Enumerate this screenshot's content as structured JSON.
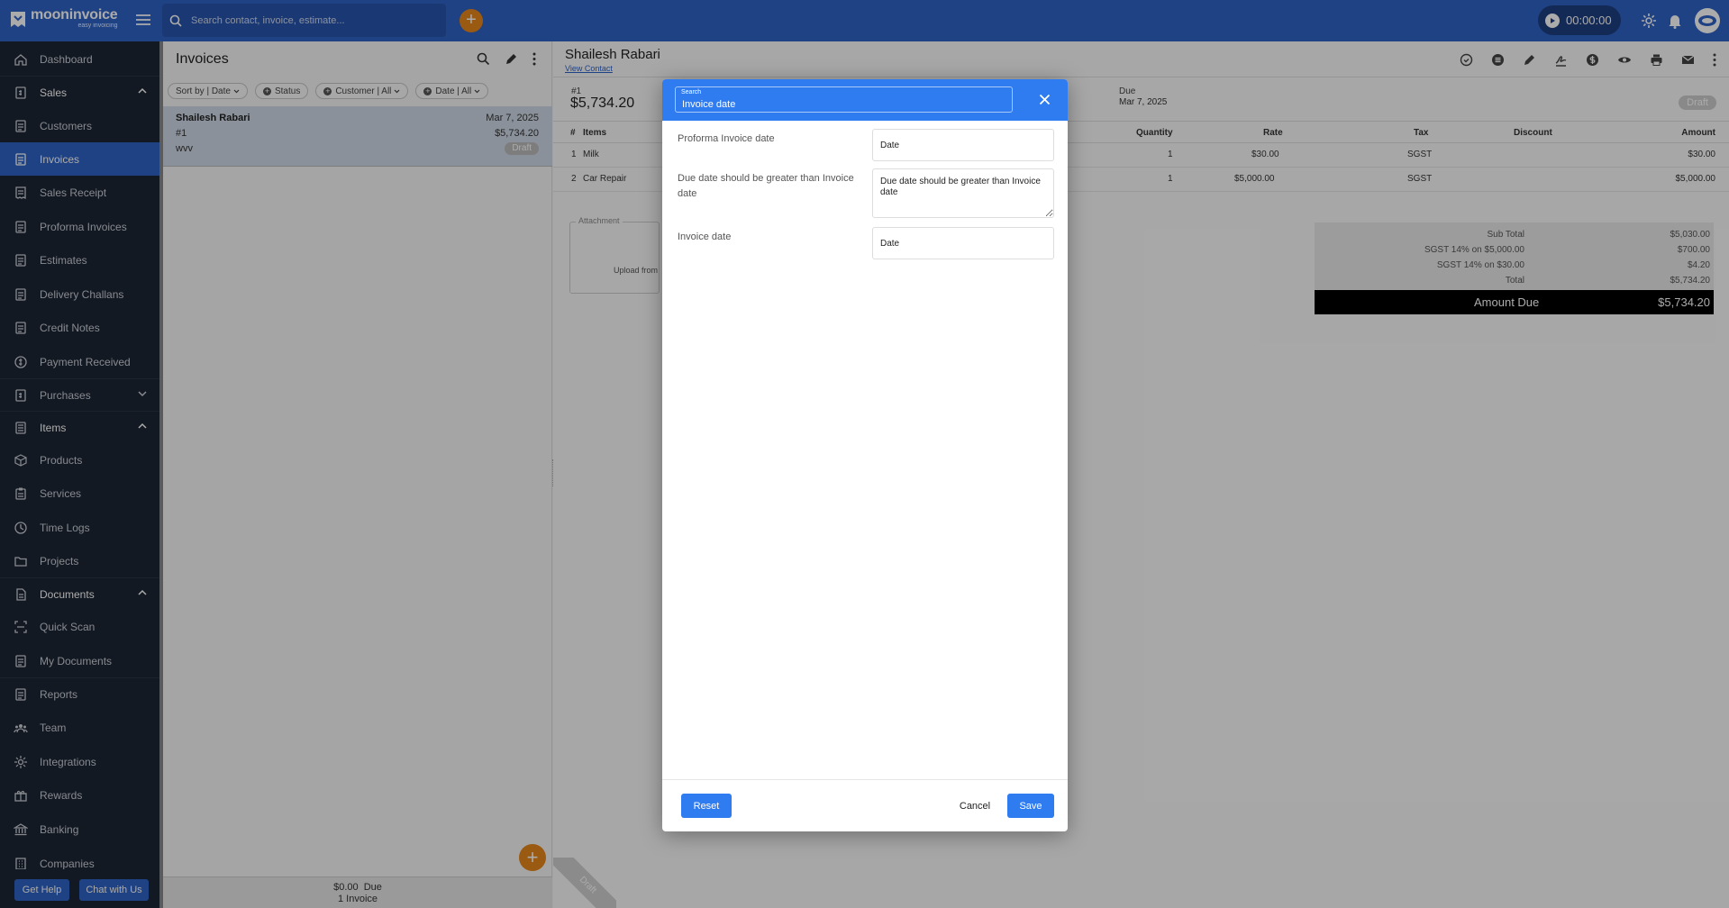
{
  "brand": {
    "name": "mooninvoice",
    "tagline": "easy invoicing"
  },
  "search": {
    "placeholder": "Search contact, invoice, estimate..."
  },
  "timer": {
    "value": "00:00:00"
  },
  "sidebar": {
    "items": [
      {
        "label": "Dashboard"
      },
      {
        "label": "Sales"
      },
      {
        "label": "Customers"
      },
      {
        "label": "Invoices"
      },
      {
        "label": "Sales Receipt"
      },
      {
        "label": "Proforma Invoices"
      },
      {
        "label": "Estimates"
      },
      {
        "label": "Delivery Challans"
      },
      {
        "label": "Credit Notes"
      },
      {
        "label": "Payment Received"
      },
      {
        "label": "Purchases"
      },
      {
        "label": "Items"
      },
      {
        "label": "Products"
      },
      {
        "label": "Services"
      },
      {
        "label": "Time Logs"
      },
      {
        "label": "Projects"
      },
      {
        "label": "Documents"
      },
      {
        "label": "Quick Scan"
      },
      {
        "label": "My Documents"
      },
      {
        "label": "Reports"
      },
      {
        "label": "Team"
      },
      {
        "label": "Integrations"
      },
      {
        "label": "Rewards"
      },
      {
        "label": "Banking"
      },
      {
        "label": "Companies"
      }
    ],
    "help_label": "Get Help",
    "chat_label": "Chat with Us"
  },
  "list": {
    "title": "Invoices",
    "filters": {
      "sort": "Sort by | Date",
      "status": "Status",
      "customer": "Customer | All",
      "date": "Date | All"
    },
    "card": {
      "name": "Shailesh Rabari",
      "date": "Mar 7, 2025",
      "number": "#1",
      "amount": "$5,734.20",
      "note": "wvv",
      "status": "Draft"
    },
    "footer": {
      "due": "$0.00  Due",
      "count": "1 Invoice"
    }
  },
  "detail": {
    "name": "Shailesh Rabari",
    "view_contact": "View Contact",
    "number": "#1",
    "amount": "$5,734.20",
    "due_label": "Due",
    "due_date": "Mar 7, 2025",
    "status": "Draft",
    "columns": {
      "num": "#",
      "items": "Items",
      "quantity": "Quantity",
      "rate": "Rate",
      "tax": "Tax",
      "discount": "Discount",
      "amount": "Amount"
    },
    "rows": [
      {
        "num": "1",
        "item": "Milk",
        "qty": "1",
        "rate": "$30.00",
        "tax": "SGST",
        "amount": "$30.00"
      },
      {
        "num": "2",
        "item": "Car Repair",
        "qty": "1",
        "rate": "$5,000.00",
        "tax": "SGST",
        "amount": "$5,000.00"
      }
    ],
    "attachment_label": "Attachment",
    "upload_label": "Upload from",
    "totals": [
      {
        "label": "Sub Total",
        "value": "$5,030.00"
      },
      {
        "label": "SGST 14% on $5,000.00",
        "value": "$700.00"
      },
      {
        "label": "SGST 14% on $30.00",
        "value": "$4.20"
      },
      {
        "label": "Total",
        "value": "$5,734.20"
      }
    ],
    "amount_due_label": "Amount Due",
    "amount_due_value": "$5,734.20",
    "ribbon": "Draft"
  },
  "modal": {
    "search_label": "Search",
    "search_value": "Invoice date",
    "rows": [
      {
        "label": "Proforma Invoice date",
        "value": "Date"
      },
      {
        "label": "Due date should be greater than Invoice date",
        "value": "Due date should be greater than Invoice date"
      },
      {
        "label": "Invoice date",
        "value": "Date"
      }
    ],
    "reset_label": "Reset",
    "cancel_label": "Cancel",
    "save_label": "Save"
  },
  "colors": {
    "topbar": "#2f63c6",
    "sidebar": "#1d2634",
    "accent": "#2f7bf0",
    "fab": "#e8861a"
  }
}
